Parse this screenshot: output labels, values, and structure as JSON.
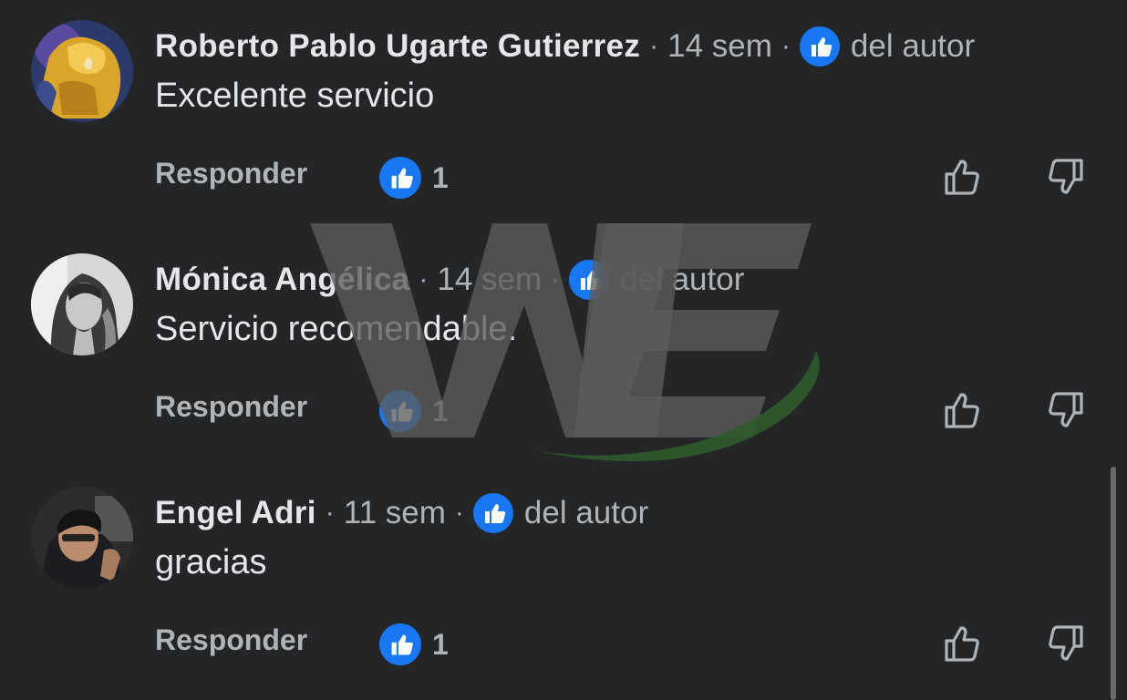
{
  "comments": [
    {
      "author": "Roberto Pablo Ugarte Gutierrez",
      "separator": "·",
      "time": "14 sem",
      "role": "del autor",
      "text": "Excelente servicio",
      "reply_label": "Responder",
      "reaction_count": "1",
      "avatar": "avatar-gold-armor"
    },
    {
      "author": "Mónica Angélica",
      "separator": "·",
      "time": "14 sem",
      "role": "del autor",
      "text": "Servicio recomendable.",
      "reply_label": "Responder",
      "reaction_count": "1",
      "avatar": "avatar-woman-bw"
    },
    {
      "author": "Engel Adri",
      "separator": "·",
      "time": "11 sem",
      "role": "del autor",
      "text": "gracias",
      "reply_label": "Responder",
      "reaction_count": "1",
      "avatar": "avatar-man-selfie"
    }
  ],
  "icons": {
    "badge": "thumbs-up-badge-icon",
    "reaction": "thumbs-up-reaction-icon",
    "like_action": "thumbs-up-outline-icon",
    "dislike_action": "thumbs-down-outline-icon"
  },
  "colors": {
    "background": "#242526",
    "primary_text": "#e4e6eb",
    "secondary_text": "#b0b3b8",
    "like_blue": "#1877f2",
    "watermark_gray": "#5c5c5c",
    "watermark_green": "#2f5a2c"
  }
}
